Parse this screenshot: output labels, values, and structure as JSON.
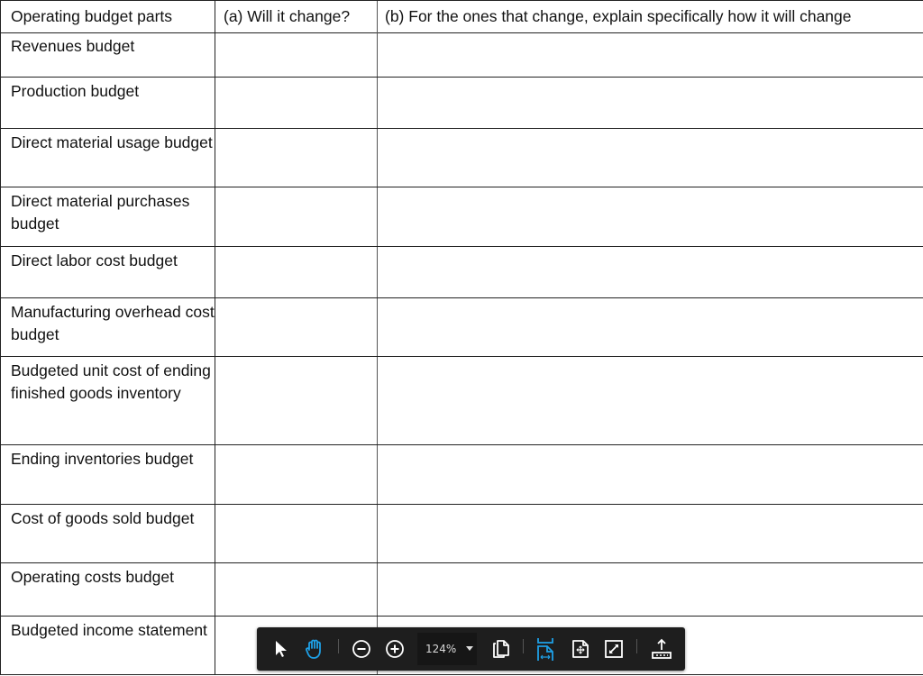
{
  "table": {
    "headers": [
      "Operating budget parts",
      "(a) Will it change?",
      "(b) For the ones that change, explain specifically how it will change"
    ],
    "rows": [
      {
        "part": "Revenues budget",
        "will_change": "",
        "explanation": ""
      },
      {
        "part": "Production budget",
        "will_change": "",
        "explanation": ""
      },
      {
        "part": "Direct material usage budget",
        "will_change": "",
        "explanation": ""
      },
      {
        "part": "Direct material purchases budget",
        "will_change": "",
        "explanation": ""
      },
      {
        "part": "Direct labor cost budget",
        "will_change": "",
        "explanation": ""
      },
      {
        "part": "Manufacturing overhead cost budget",
        "will_change": "",
        "explanation": ""
      },
      {
        "part": "Budgeted unit cost of ending finished goods inventory",
        "will_change": "",
        "explanation": ""
      },
      {
        "part": "Ending inventories budget",
        "will_change": "",
        "explanation": ""
      },
      {
        "part": "Cost of goods sold budget",
        "will_change": "",
        "explanation": ""
      },
      {
        "part": "Operating costs budget",
        "will_change": "",
        "explanation": ""
      },
      {
        "part": "Budgeted income statement",
        "will_change": "",
        "explanation": ""
      }
    ]
  },
  "toolbar": {
    "zoom_level": "124%",
    "active_tool": "hand-tool",
    "active_color": "#1ea0e6",
    "icon_color": "#ffffff",
    "tools": [
      {
        "name": "select-tool",
        "icon": "pointer-arrow-icon"
      },
      {
        "name": "hand-tool",
        "icon": "hand-icon"
      },
      {
        "name": "zoom-out",
        "icon": "zoom-out-icon"
      },
      {
        "name": "zoom-in",
        "icon": "zoom-in-icon"
      },
      {
        "name": "zoom-dropdown",
        "icon": "caret-down-icon"
      },
      {
        "name": "page-view",
        "icon": "copy-pages-icon"
      },
      {
        "name": "fit-width",
        "icon": "fit-width-icon"
      },
      {
        "name": "fit-page",
        "icon": "fit-page-icon"
      },
      {
        "name": "fullscreen",
        "icon": "expand-icon"
      },
      {
        "name": "export",
        "icon": "upload-icon"
      }
    ]
  }
}
